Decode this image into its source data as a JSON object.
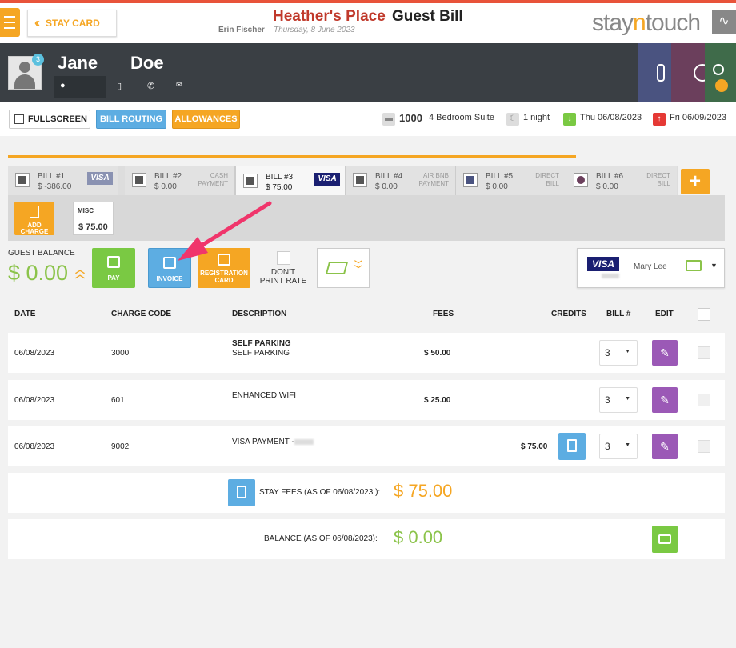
{
  "header": {
    "stay_card": "STAY CARD",
    "hotel_name": "Heather's Place",
    "page_title": "Guest Bill",
    "user_name": "Erin Fischer",
    "business_date": "Thursday, 8 June 2023",
    "logo_part1": "stay",
    "logo_part2": "n",
    "logo_part3": "touch"
  },
  "guest": {
    "first_name": "Jane",
    "last_name": "Doe",
    "vip_count": "3"
  },
  "controls": {
    "fullscreen": "FULLSCREEN",
    "bill_routing": "BILL ROUTING",
    "allowances": "ALLOWANCES",
    "room_number": "1000",
    "room_type": "4 Bedroom Suite",
    "nights": "1 night",
    "arrival": "Thu 06/08/2023",
    "departure": "Fri 06/09/2023"
  },
  "bill_tabs": [
    {
      "name": "BILL #1",
      "amount": "$ -386.00",
      "type": "VISA"
    },
    {
      "name": "BILL #2",
      "amount": "$ 0.00",
      "type": "CASH PAYMENT"
    },
    {
      "name": "BILL #3",
      "amount": "$ 75.00",
      "type": "VISA"
    },
    {
      "name": "BILL #4",
      "amount": "$ 0.00",
      "type": "AIR BNB PAYMENT"
    },
    {
      "name": "BILL #5",
      "amount": "$ 0.00",
      "type": "DIRECT BILL"
    },
    {
      "name": "BILL #6",
      "amount": "$ 0.00",
      "type": "DIRECT BILL"
    }
  ],
  "add_bill": "+",
  "charges_panel": {
    "add_charge": "ADD CHARGE",
    "misc_label": "MISC",
    "misc_amount": "$ 75.00"
  },
  "balance_bar": {
    "guest_balance_label": "GUEST BALANCE",
    "guest_balance": "$ 0.00",
    "pay": "PAY",
    "invoice": "INVOICE",
    "registration_card": "REGISTRATION CARD",
    "dont_print_rate": "DON'T PRINT RATE",
    "card_brand": "VISA",
    "card_holder": "Mary Lee"
  },
  "table": {
    "headers": [
      "DATE",
      "CHARGE CODE",
      "DESCRIPTION",
      "FEES",
      "CREDITS",
      "BILL #",
      "EDIT"
    ],
    "rows": [
      {
        "date": "06/08/2023",
        "code": "3000",
        "desc1": "SELF PARKING",
        "desc2": "SELF PARKING",
        "fees": "$ 50.00",
        "credits": "",
        "bill": "3"
      },
      {
        "date": "06/08/2023",
        "code": "601",
        "desc1": "ENHANCED WIFI",
        "desc2": "",
        "fees": "$ 25.00",
        "credits": "",
        "bill": "3"
      },
      {
        "date": "06/08/2023",
        "code": "9002",
        "desc1": "VISA PAYMENT -",
        "desc2": "",
        "fees": "",
        "credits": "$ 75.00",
        "bill": "3"
      }
    ]
  },
  "summary": {
    "stay_fees_label": "STAY FEES (AS OF  06/08/2023 ):",
    "stay_fees": "$ 75.00",
    "balance_label": "BALANCE (AS OF  06/08/2023):",
    "balance": "$ 0.00"
  },
  "colors": {
    "accent_orange": "#f5a623",
    "accent_blue": "#5dade2",
    "accent_green": "#7ac943",
    "accent_purple": "#9b59b6",
    "annotation_arrow": "#f0356b"
  }
}
